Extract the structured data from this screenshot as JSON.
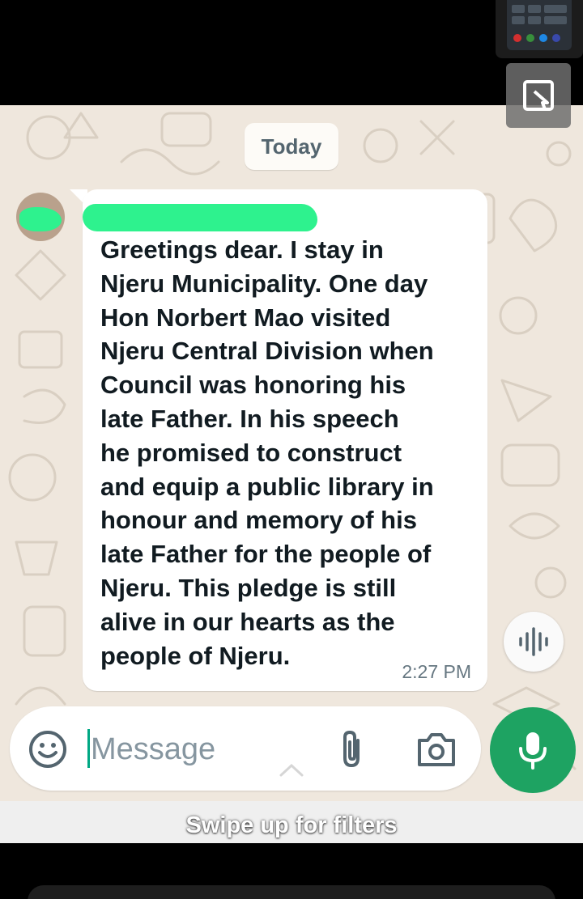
{
  "chat": {
    "date_chip": "Today",
    "message": {
      "text": "Greetings dear. I stay in\nNjeru Municipality. One day\nHon Norbert Mao visited\nNjeru Central Division when\nCouncil was honoring his\nlate Father. In his speech\nhe promised to construct\nand equip a public library in\nhonour and memory of his\nlate Father for the people of\nNjeru.  This pledge is still\nalive in our hearts as the\npeople of Njeru.",
      "time": "2:27 PM"
    }
  },
  "composer": {
    "placeholder": "Message"
  },
  "overlay": {
    "filter_hint": "Swipe up for filters"
  },
  "icons": {
    "emoji": "emoji-icon",
    "attach": "paperclip-icon",
    "camera": "camera-icon",
    "mic": "microphone-icon",
    "voice": "voice-waveform-icon",
    "crop": "crop-icon",
    "chevron": "chevron-up-icon"
  },
  "colors": {
    "chat_background": "#efe7dd",
    "bubble": "#ffffff",
    "mic_button": "#1ea362",
    "caret": "#00a884",
    "redaction_marker": "#2ef28e"
  }
}
